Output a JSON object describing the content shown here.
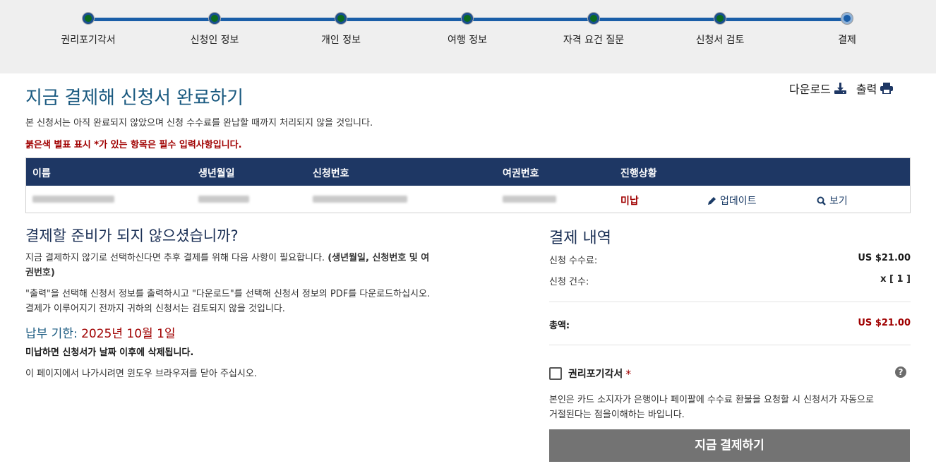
{
  "steps": [
    {
      "label": "권리포기각서"
    },
    {
      "label": "신청인 정보"
    },
    {
      "label": "개인 정보"
    },
    {
      "label": "여행 정보"
    },
    {
      "label": "자격 요건 질문"
    },
    {
      "label": "신청서 검토"
    },
    {
      "label": "결제"
    }
  ],
  "actions": {
    "download": "다운로드",
    "print": "출력"
  },
  "page": {
    "title": "지금 결제해 신청서 완료하기",
    "intro": "본 신청서는 아직 완료되지 않았으며 신청 수수료를 완납할 때까지 처리되지 않을 것입니다.",
    "required_note": "붉은색 별표 표시 *가 있는 항목은 필수 입력사항입니다."
  },
  "table": {
    "headers": [
      "이름",
      "생년월일",
      "신청번호",
      "여권번호",
      "진행상황"
    ],
    "row": {
      "status": "미납",
      "update": "업데이트",
      "view": "보기"
    }
  },
  "not_ready": {
    "title": "결제할 준비가 되지 않으셨습니까?",
    "p1_start": "지금 결제하지 않기로 선택하신다면 추후 결제를 위해 다음 사항이 필요합니다. ",
    "p1_bold_a": "(생년월일, 신청번호 및 여",
    "p1_bold_b": "권번호)",
    "p2_line1": "\"출력\"을 선택해 신청서 정보를 출력하시고 \"다운로드\"를 선택해 신청서 정보의 PDF를 다운로드하십시오.",
    "p2_line2": "결제가 이루어지기 전까지 귀하의 신청서는 검토되지 않을 것입니다.",
    "deadline_label": "납부 기한: ",
    "deadline_date": "2025년 10월 1일",
    "delete_note": "미납하면 신청서가 날짜 이후에 삭제됩니다.",
    "close_note": "이 페이지에서 나가시려면 윈도우 브라우저를 닫아 주십시오."
  },
  "summary": {
    "title": "결제 내역",
    "fee_label": "신청 수수료:",
    "fee_value": "US $21.00",
    "count_label": "신청 건수:",
    "count_value": "x [ 1 ]",
    "total_label": "총액:",
    "total_value": "US $21.00"
  },
  "waiver": {
    "label": "권리포기각서",
    "star": "*",
    "help": "?",
    "text_line1": "본인은 카드 소지자가 은행이나 페이팔에 수수료 환불을 요청할 시 신청서가 자동으로",
    "text_line2": "거절된다는 점을이해하는 바입니다."
  },
  "pay_button": "지금 결제하기",
  "colors": {
    "header_bg": "#1e3764",
    "accent": "#1a5a80",
    "error": "#a00000",
    "button": "#737373"
  }
}
